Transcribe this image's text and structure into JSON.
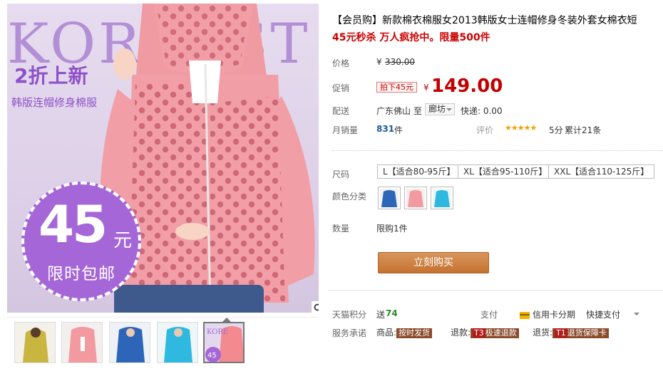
{
  "product": {
    "title": "【会员购】新款棉衣棉服女2013韩版女士连帽修身冬装外套女棉衣短",
    "subtitle": "45元秒杀 万人疯抢中。限量500件"
  },
  "gallery": {
    "brand_text": "KOREAST",
    "promo_title": "2折上新",
    "promo_sub": "韩版连帽修身棉服",
    "circle_number": "45",
    "circle_unit": "元",
    "circle_text": "限时包邮",
    "thumb_overlay_text": "KORE",
    "thumb_overlay_num": "45",
    "thumbnails": [
      {
        "color": "#c8b640"
      },
      {
        "color": "#f29aa0"
      },
      {
        "color": "#2d65b8"
      },
      {
        "color": "#2fb8e0"
      },
      {
        "color": "#f28a90"
      }
    ]
  },
  "price": {
    "label": "价格",
    "currency": "¥",
    "original": "330.00"
  },
  "promo_price": {
    "label": "促销",
    "tag": "拍下45元",
    "currency": "¥",
    "value": "149.00"
  },
  "shipping": {
    "label": "配送",
    "from": "广东佛山",
    "to_label": "至",
    "destination": "廊坊",
    "express": "快递: 0.00"
  },
  "sales": {
    "label": "月销量",
    "count": "831",
    "unit": "件",
    "rating_label": "评价",
    "stars": "★★★★★",
    "score": "5分",
    "total": "累计21条"
  },
  "sizes": {
    "label": "尺码",
    "options": [
      "L【适合80-95斤】",
      "XL【适合95-110斤】",
      "XXL【适合110-125斤】"
    ]
  },
  "colors": {
    "label": "颜色分类",
    "swatches": [
      "#2d65b8",
      "#f29aa0",
      "#2fb8e0"
    ]
  },
  "quantity": {
    "label": "数量",
    "limit": "限购1件"
  },
  "buy_button": "立刻购买",
  "points": {
    "label": "天猫积分",
    "prefix": "送",
    "value": "74"
  },
  "payment": {
    "label": "支付",
    "credit": "信用卡分期",
    "quick": "快捷支付"
  },
  "commitment": {
    "label": "服务承诺",
    "goods_label": "商品:",
    "goods_tag": "按时发货",
    "refund_label": "退款:",
    "refund_code": "T3",
    "refund_tag": "极速退款",
    "return_label": "退货:",
    "return_code": "T1",
    "return_tag": "退货保障卡"
  },
  "colors_theme": {
    "price_red": "#c40000",
    "buy_orange": "#c57232",
    "promo_purple": "#8e52c9",
    "jacket_pink": "#f0909a"
  }
}
